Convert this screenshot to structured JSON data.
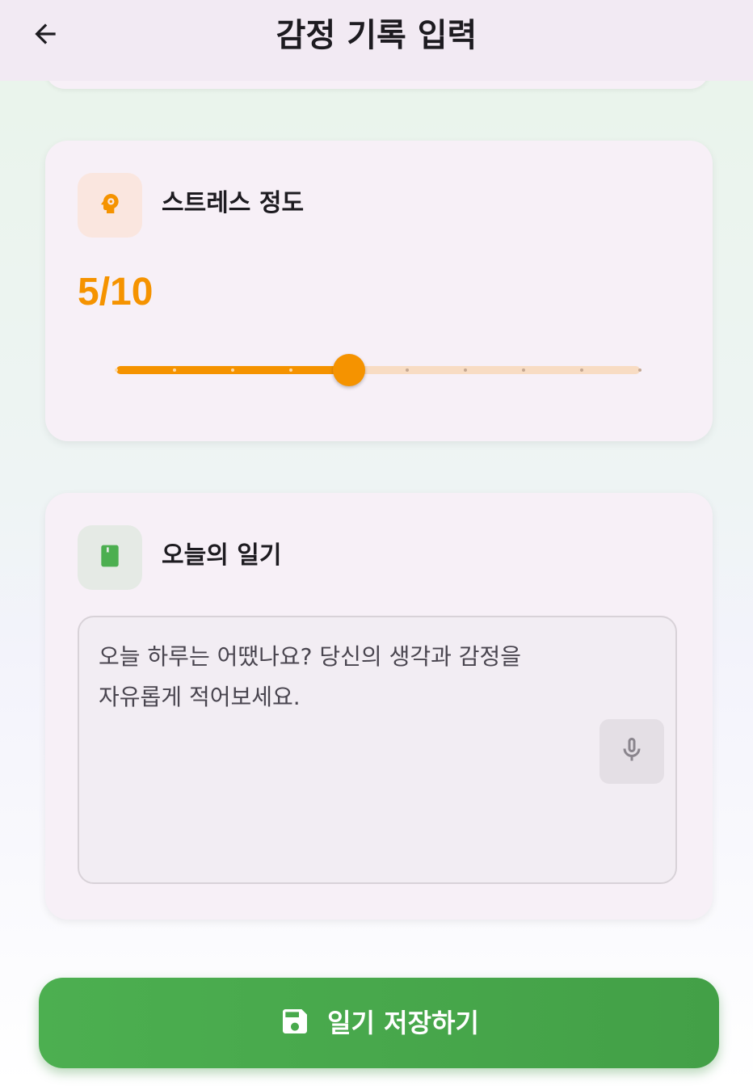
{
  "app_bar": {
    "title": "감정 기록 입력",
    "back_icon": "arrow-left-icon"
  },
  "stress_card": {
    "title": "스트레스 정도",
    "icon": "psychology-head-icon",
    "value_text": "5/10",
    "value": 5,
    "min": 1,
    "max": 10,
    "accent_color": "#f59300",
    "track_color": "#f8dcc3"
  },
  "diary_card": {
    "title": "오늘의 일기",
    "icon": "book-icon",
    "icon_color": "#4caf50",
    "placeholder_line1": "오늘 하루는 어땠나요? 당신의 생각과 감정을",
    "placeholder_line2": "자유롭게 적어보세요.",
    "mic_icon": "microphone-icon"
  },
  "save_button": {
    "label": "일기 저장하기",
    "icon": "save-icon",
    "color": "#4caf50"
  }
}
